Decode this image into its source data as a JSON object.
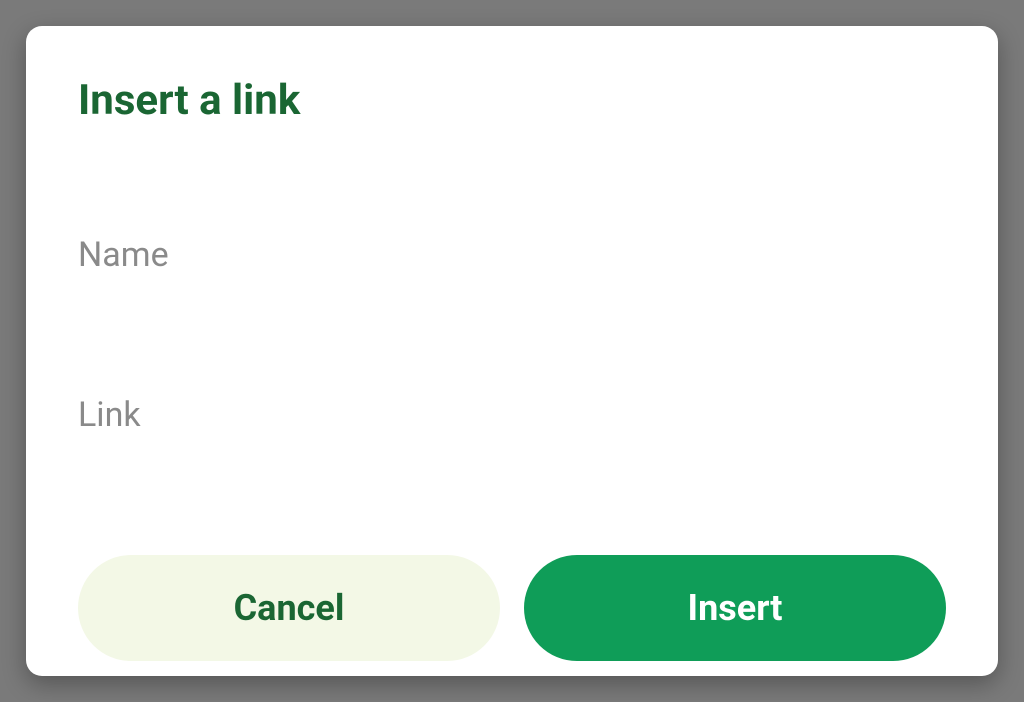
{
  "dialog": {
    "title": "Insert a link",
    "fields": {
      "name": {
        "label": "Name",
        "value": ""
      },
      "link": {
        "label": "Link",
        "value": ""
      }
    },
    "buttons": {
      "cancel": "Cancel",
      "insert": "Insert"
    }
  },
  "colors": {
    "accent": "#1a6633",
    "primary": "#0f9d58",
    "cancel_bg": "#f3f8e6",
    "label_gray": "#8a8a8a"
  }
}
